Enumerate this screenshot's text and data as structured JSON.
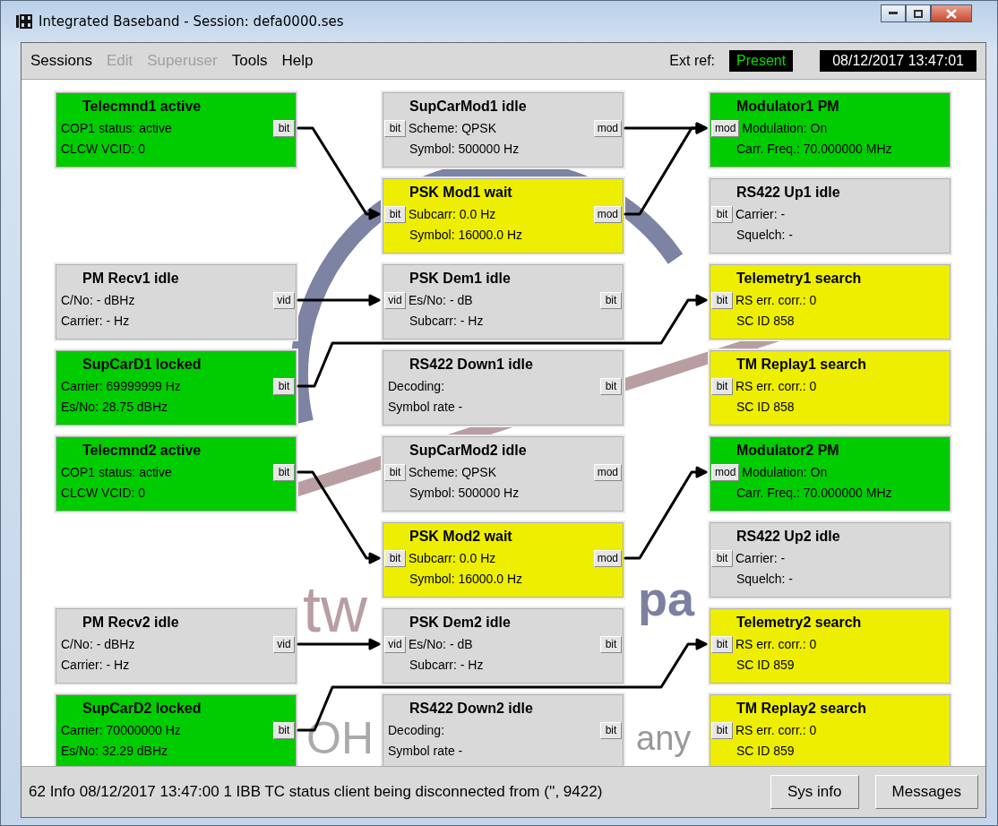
{
  "window": {
    "title": "Integrated Baseband - Session: defa0000.ses"
  },
  "menu": [
    {
      "label": "Sessions",
      "disabled": false
    },
    {
      "label": "Edit",
      "disabled": true
    },
    {
      "label": "Superuser",
      "disabled": true
    },
    {
      "label": "Tools",
      "disabled": false
    },
    {
      "label": "Help",
      "disabled": false
    }
  ],
  "ext_ref": {
    "label": "Ext ref:",
    "value": "Present"
  },
  "datetime": "08/12/2017 13:47:01",
  "logo_fragments": [
    "tw",
    "pa",
    "OH",
    "any"
  ],
  "columns": [
    [
      {
        "kind": "block",
        "title": "Telecmnd1 active",
        "color": "#00cc00",
        "right_port": "bit",
        "lines": [
          "COP1 status: active",
          "CLCW VCID: 0"
        ]
      },
      {
        "kind": "empty"
      },
      {
        "kind": "block",
        "title": "PM Recv1 idle",
        "color": "#d9d9d9",
        "right_port": "vid",
        "lines": [
          "C/No: - dBHz",
          "Carrier: - Hz"
        ]
      },
      {
        "kind": "block",
        "title": "SupCarD1 locked",
        "color": "#00cc00",
        "right_port": "bit",
        "lines": [
          "Carrier: 69999999 Hz",
          "Es/No: 28.75 dBHz"
        ]
      },
      {
        "kind": "block",
        "title": "Telecmnd2 active",
        "color": "#00cc00",
        "right_port": "bit",
        "lines": [
          "COP1 status: active",
          "CLCW VCID: 0"
        ]
      },
      {
        "kind": "empty"
      },
      {
        "kind": "block",
        "title": "PM Recv2 idle",
        "color": "#d9d9d9",
        "right_port": "vid",
        "lines": [
          "C/No: - dBHz",
          "Carrier: - Hz"
        ]
      },
      {
        "kind": "block",
        "title": "SupCarD2 locked",
        "color": "#00cc00",
        "right_port": "bit",
        "lines": [
          "Carrier: 70000000 Hz",
          "Es/No: 32.29 dBHz"
        ]
      }
    ],
    [
      {
        "kind": "block",
        "title": "SupCarMod1 idle",
        "color": "#d9d9d9",
        "left_port": "bit",
        "right_port": "mod",
        "lines": [
          "Scheme: QPSK",
          "Symbol: 500000 Hz"
        ]
      },
      {
        "kind": "block",
        "title": "PSK Mod1 wait",
        "color": "#eeee00",
        "left_port": "bit",
        "right_port": "mod",
        "lines": [
          "Subcarr: 0.0 Hz",
          "Symbol: 16000.0 Hz"
        ]
      },
      {
        "kind": "block",
        "title": "PSK Dem1 idle",
        "color": "#d9d9d9",
        "left_port": "vid",
        "right_port": "bit",
        "lines": [
          "Es/No: - dB",
          "Subcarr: - Hz"
        ]
      },
      {
        "kind": "block",
        "title": "RS422 Down1 idle",
        "color": "#d9d9d9",
        "right_port": "bit",
        "lines": [
          "Decoding:",
          "Symbol rate -"
        ]
      },
      {
        "kind": "block",
        "title": "SupCarMod2 idle",
        "color": "#d9d9d9",
        "left_port": "bit",
        "right_port": "mod",
        "lines": [
          "Scheme: QPSK",
          "Symbol: 500000 Hz"
        ]
      },
      {
        "kind": "block",
        "title": "PSK Mod2 wait",
        "color": "#eeee00",
        "left_port": "bit",
        "right_port": "mod",
        "lines": [
          "Subcarr: 0.0 Hz",
          "Symbol: 16000.0 Hz"
        ]
      },
      {
        "kind": "block",
        "title": "PSK Dem2 idle",
        "color": "#d9d9d9",
        "left_port": "vid",
        "right_port": "bit",
        "lines": [
          "Es/No: - dB",
          "Subcarr: - Hz"
        ]
      },
      {
        "kind": "block",
        "title": "RS422 Down2 idle",
        "color": "#d9d9d9",
        "right_port": "bit",
        "lines": [
          "Decoding:",
          "Symbol rate -"
        ]
      }
    ],
    [
      {
        "kind": "block",
        "title": "Modulator1 PM",
        "color": "#00cc00",
        "left_port": "mod",
        "lines": [
          "Modulation: On",
          "Carr. Freq.: 70.000000 MHz"
        ]
      },
      {
        "kind": "block",
        "title": "RS422 Up1 idle",
        "color": "#d9d9d9",
        "left_port": "bit",
        "lines": [
          "Carrier: -",
          "Squelch: -"
        ]
      },
      {
        "kind": "block",
        "title": "Telemetry1 search",
        "color": "#eeee00",
        "left_port": "bit",
        "lines": [
          "RS err. corr.: 0",
          "SC ID 858"
        ]
      },
      {
        "kind": "block",
        "title": "TM Replay1 search",
        "color": "#eeee00",
        "left_port": "bit",
        "lines": [
          "RS err. corr.: 0",
          "SC ID 858"
        ]
      },
      {
        "kind": "block",
        "title": "Modulator2 PM",
        "color": "#00cc00",
        "left_port": "mod",
        "lines": [
          "Modulation: On",
          "Carr. Freq.: 70.000000 MHz"
        ]
      },
      {
        "kind": "block",
        "title": "RS422 Up2 idle",
        "color": "#d9d9d9",
        "left_port": "bit",
        "lines": [
          "Carrier: -",
          "Squelch: -"
        ]
      },
      {
        "kind": "block",
        "title": "Telemetry2 search",
        "color": "#eeee00",
        "left_port": "bit",
        "lines": [
          "RS err. corr.: 0",
          "SC ID 859"
        ]
      },
      {
        "kind": "block",
        "title": "TM Replay2 search",
        "color": "#eeee00",
        "left_port": "bit",
        "lines": [
          "RS err. corr.: 0",
          "SC ID 859"
        ]
      }
    ]
  ],
  "status_bar": {
    "message": "62 Info 08/12/2017 13:47:00 1 IBB TC status client being disconnected from ('', 9422)",
    "buttons": [
      "Sys info",
      "Messages"
    ]
  }
}
